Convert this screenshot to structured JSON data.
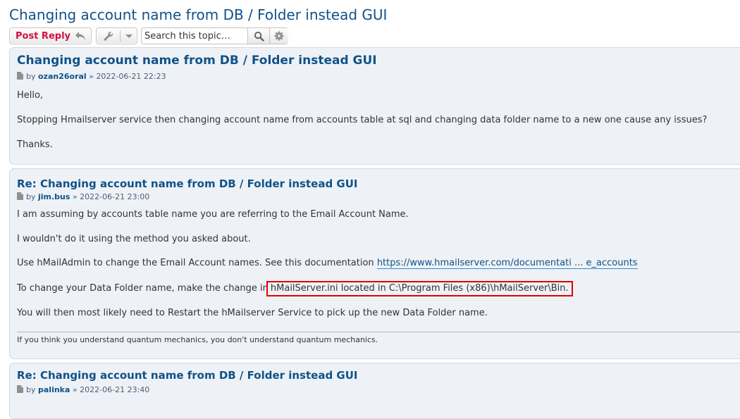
{
  "topic": {
    "title": "Changing account name from DB / Folder instead GUI"
  },
  "actions": {
    "post_reply_label": "Post Reply",
    "search_placeholder": "Search this topic…"
  },
  "icons": {
    "reply": "reply-arrow-icon",
    "tools": "wrench-icon",
    "dropdown": "caret-down-icon",
    "search": "magnifier-icon",
    "advanced_search": "gear-icon",
    "post": "page-icon"
  },
  "colors": {
    "link": "#105289",
    "reply_button": "#d31141",
    "post_bg": "#eef2f6",
    "highlight_box": "#e20000"
  },
  "posts": [
    {
      "title": "Changing account name from DB / Folder instead GUI",
      "by": "by",
      "author": "ozan26oral",
      "separator": "»",
      "date": "2022-06-21 22:23",
      "paragraphs": [
        "Hello,",
        "Stopping Hmailserver service then changing account name from accounts table at sql and changing data folder name to a new one cause any issues?",
        "Thanks."
      ]
    },
    {
      "title": "Re: Changing account name from DB / Folder instead GUI",
      "by": "by",
      "author": "jim.bus",
      "separator": "»",
      "date": "2022-06-21 23:00",
      "p1": "I am assuming by accounts table name you are referring to the Email Account Name.",
      "p2": "I wouldn't do it using the method you asked about.",
      "p3_prefix": "Use hMailAdmin to change the Email Account names. See this documentation ",
      "p3_link": "https://www.hmailserver.com/documentati ... e_accounts",
      "p4_prefix": "To change your Data Folder name, make the change in",
      "p4_highlight": "hMailServer.ini located in C:\\Program Files (x86)\\hMailServer\\Bin.",
      "p5": "You will then most likely need to Restart the hMailserver Service to pick up the new Data Folder name.",
      "signature": "If you think you understand quantum mechanics, you don't understand quantum mechanics."
    },
    {
      "title": "Re: Changing account name from DB / Folder instead GUI",
      "by": "by",
      "author": "palinka",
      "separator": "»",
      "date": "2022-06-21 23:40"
    }
  ]
}
